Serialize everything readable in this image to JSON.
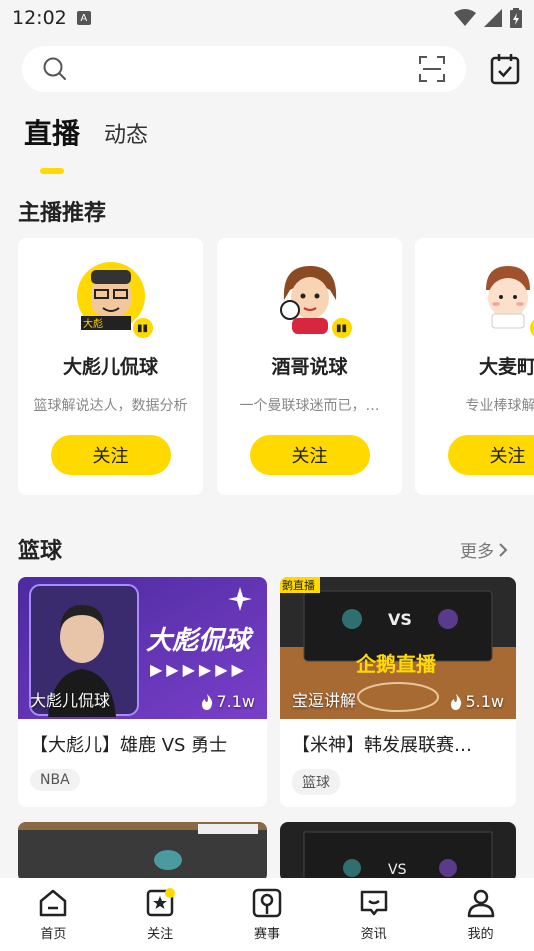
{
  "status_bar": {
    "time": "12:02",
    "notif_icon_letter": "A"
  },
  "search": {
    "placeholder": ""
  },
  "tabs": [
    {
      "label": "直播",
      "active": true
    },
    {
      "label": "动态",
      "active": false
    }
  ],
  "streamers_section": {
    "title": "主播推荐",
    "cards": [
      {
        "name": "大彪儿侃球",
        "desc": "篮球解说达人，数据分析",
        "follow": "关注"
      },
      {
        "name": "酒哥说球",
        "desc": "一个曼联球迷而已，…",
        "follow": "关注"
      },
      {
        "name": "大麦町",
        "desc": "专业棒球解说",
        "follow": "关注"
      }
    ]
  },
  "basketball_section": {
    "title": "篮球",
    "more": "更多",
    "videos": [
      {
        "thumb_label": "大彪儿侃球",
        "views": "7.1w",
        "title": "【大彪儿】雄鹿 VS 勇士",
        "tag": "NBA",
        "banner_text": "大彪侃球"
      },
      {
        "thumb_label": "宝逗讲解",
        "views": "5.1w",
        "title": "【米神】韩发展联赛…",
        "tag": "篮球",
        "banner_text": "企鹅直播",
        "corner_text": "鹅直播"
      }
    ]
  },
  "bottom_nav": [
    {
      "label": "首页",
      "icon": "home-icon"
    },
    {
      "label": "关注",
      "icon": "follow-icon"
    },
    {
      "label": "赛事",
      "icon": "match-icon"
    },
    {
      "label": "资讯",
      "icon": "news-icon"
    },
    {
      "label": "我的",
      "icon": "profile-icon"
    }
  ],
  "colors": {
    "accent": "#ffd900",
    "background": "#f5f5f5"
  }
}
